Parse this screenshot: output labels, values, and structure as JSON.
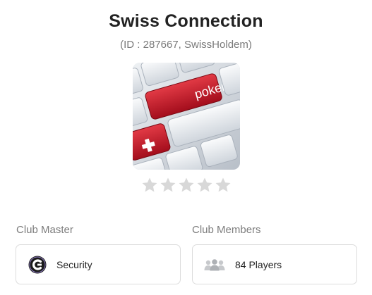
{
  "club": {
    "name": "Swiss Connection",
    "id_line": "(ID : 287667, SwissHoldem)",
    "image_icon": "poker-keyboard-image",
    "image_key_text": "poker",
    "rating": 0,
    "rating_max": 5
  },
  "club_master": {
    "label": "Club Master",
    "name": "Security",
    "avatar_icon": "c-logo-avatar-icon"
  },
  "club_members": {
    "label": "Club Members",
    "count_text": "84 Players",
    "icon": "players-group-icon"
  },
  "colors": {
    "star_empty": "#d8d8d8",
    "label_gray": "#7d7d7d",
    "card_border": "#dcdcdc",
    "key_red": "#c8102e"
  }
}
